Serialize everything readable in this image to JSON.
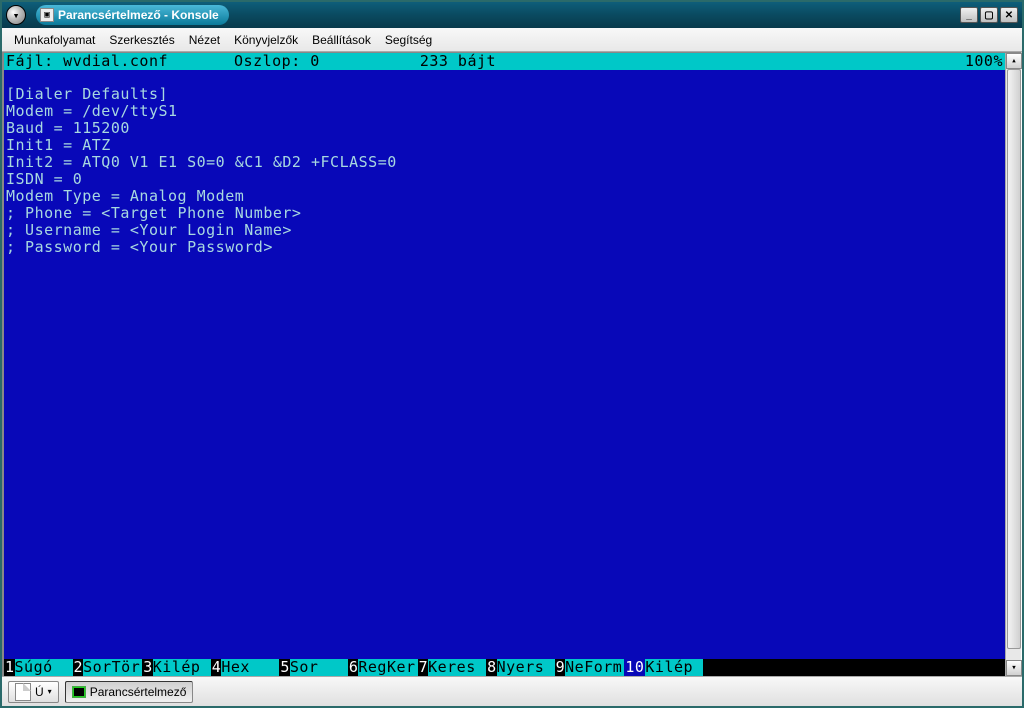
{
  "window": {
    "title": "Parancsértelmező - Konsole"
  },
  "menu": {
    "items": [
      "Munkafolyamat",
      "Szerkesztés",
      "Nézet",
      "Könyvjelzők",
      "Beállítások",
      "Segítség"
    ]
  },
  "status": {
    "file_label": "Fájl: wvdial.conf",
    "column_label": "Oszlop: 0",
    "bytes_label": "233 bájt",
    "percent": "100%"
  },
  "file_content": [
    "[Dialer Defaults]",
    "Modem = /dev/ttyS1",
    "Baud = 115200",
    "Init1 = ATZ",
    "Init2 = ATQ0 V1 E1 S0=0 &C1 &D2 +FCLASS=0",
    "ISDN = 0",
    "Modem Type = Analog Modem",
    "; Phone = <Target Phone Number>",
    "; Username = <Your Login Name>",
    "; Password = <Your Password>"
  ],
  "fnkeys": [
    {
      "n": "1",
      "label": "Súgó",
      "hl": true
    },
    {
      "n": "2",
      "label": "SorTör",
      "hl": true
    },
    {
      "n": "3",
      "label": "Kilép",
      "hl": true
    },
    {
      "n": "4",
      "label": "Hex",
      "hl": true
    },
    {
      "n": "5",
      "label": "Sor",
      "hl": true
    },
    {
      "n": "6",
      "label": "RegKer",
      "hl": true
    },
    {
      "n": "7",
      "label": "Keres",
      "hl": true
    },
    {
      "n": "8",
      "label": "Nyers",
      "hl": true
    },
    {
      "n": "9",
      "label": "NeForm",
      "hl": true
    },
    {
      "n": "10",
      "label": "Kilép",
      "hl": true
    }
  ],
  "bottombar": {
    "new_label": "Ú",
    "tab_label": "Parancsértelmező"
  }
}
